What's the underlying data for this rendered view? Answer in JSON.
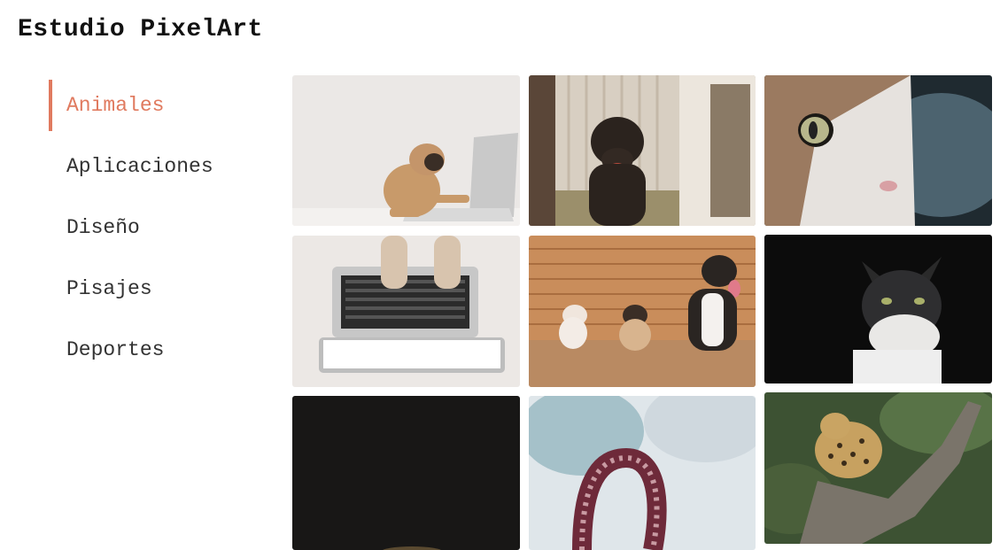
{
  "site": {
    "title": "Estudio PixelArt"
  },
  "nav": {
    "items": [
      {
        "label": "Animales",
        "active": true
      },
      {
        "label": "Aplicaciones",
        "active": false
      },
      {
        "label": "Diseño",
        "active": false
      },
      {
        "label": "Pisajes",
        "active": false
      },
      {
        "label": "Deportes",
        "active": false
      }
    ],
    "accent_color": "#e07a5f"
  },
  "gallery": {
    "photos": [
      {
        "subject": "pug at laptop"
      },
      {
        "subject": "black dog on porch"
      },
      {
        "subject": "cat eye close-up"
      },
      {
        "subject": "dog paws on laptop keyboard"
      },
      {
        "subject": "three dogs on wooden deck"
      },
      {
        "subject": "black and white cat"
      },
      {
        "subject": "dark photo"
      },
      {
        "subject": "octopus tentacle"
      },
      {
        "subject": "leopard in tree"
      }
    ]
  }
}
